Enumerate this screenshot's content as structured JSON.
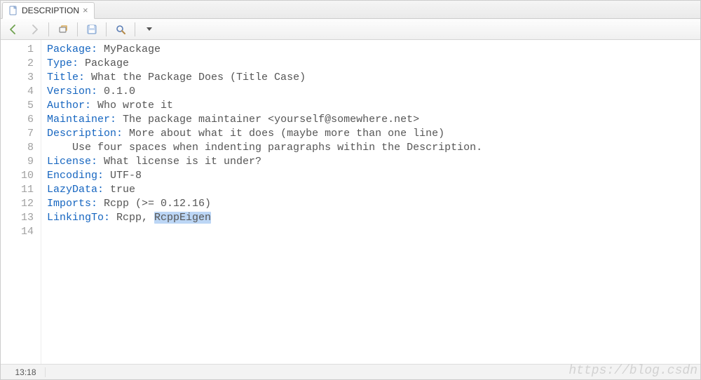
{
  "tab": {
    "title": "DESCRIPTION",
    "close_glyph": "×"
  },
  "toolbar": {
    "back": "back",
    "forward": "forward",
    "popout": "popout",
    "save": "save",
    "search": "search",
    "dropdown": "dropdown"
  },
  "code": {
    "lines": [
      {
        "n": "1",
        "key": "Package:",
        "val": " MyPackage"
      },
      {
        "n": "2",
        "key": "Type:",
        "val": " Package"
      },
      {
        "n": "3",
        "key": "Title:",
        "val": " What the Package Does (Title Case)"
      },
      {
        "n": "4",
        "key": "Version:",
        "val": " 0.1.0"
      },
      {
        "n": "5",
        "key": "Author:",
        "val": " Who wrote it"
      },
      {
        "n": "6",
        "key": "Maintainer:",
        "val": " The package maintainer <yourself@somewhere.net>"
      },
      {
        "n": "7",
        "key": "Description:",
        "val": " More about what it does (maybe more than one line)"
      },
      {
        "n": "8",
        "key": "",
        "val": "    Use four spaces when indenting paragraphs within the Description."
      },
      {
        "n": "9",
        "key": "License:",
        "val": " What license is it under?"
      },
      {
        "n": "10",
        "key": "Encoding:",
        "val": " UTF-8"
      },
      {
        "n": "11",
        "key": "LazyData:",
        "val": " true"
      },
      {
        "n": "12",
        "key": "Imports:",
        "val": " Rcpp (>= 0.12.16)"
      },
      {
        "n": "13",
        "key": "LinkingTo:",
        "val_prefix": " Rcpp, ",
        "val_sel": "RcppEigen"
      },
      {
        "n": "14",
        "key": "",
        "val": ""
      }
    ]
  },
  "status": {
    "cursor": "13:18"
  },
  "watermark": "https://blog.csdn"
}
